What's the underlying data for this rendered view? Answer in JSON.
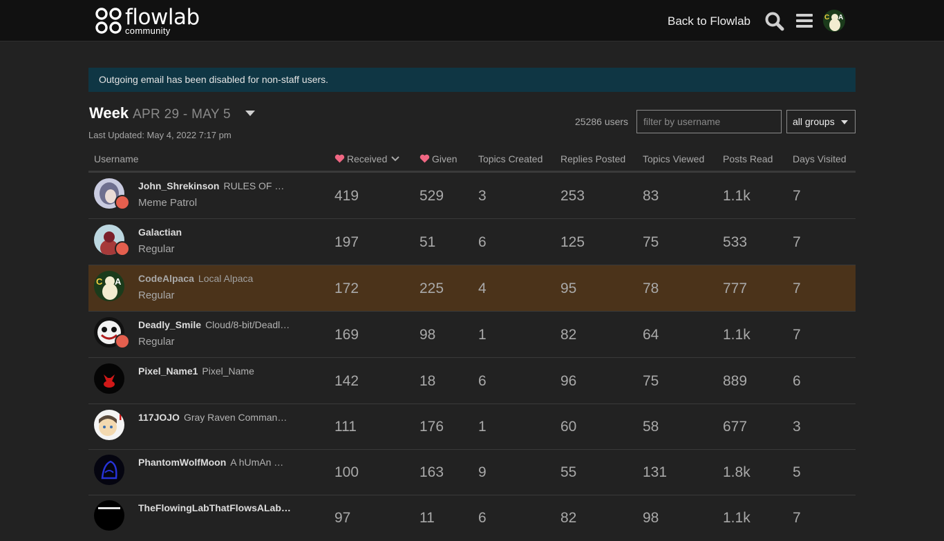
{
  "header": {
    "logo_name": "flowlab",
    "logo_sub": "community",
    "back_link": "Back to Flowlab",
    "search_icon": "search-icon",
    "menu_icon": "hamburger-icon"
  },
  "alert": "Outgoing email has been disabled for non-staff users.",
  "period": {
    "word": "Week",
    "range": "APR 29 - MAY 5",
    "last_updated": "Last Updated: May 4, 2022 7:17 pm"
  },
  "filters": {
    "user_count": "25286 users",
    "placeholder": "filter by username",
    "group": "all groups"
  },
  "columns": {
    "username": "Username",
    "received": "Received",
    "given": "Given",
    "topics_created": "Topics Created",
    "replies_posted": "Replies Posted",
    "topics_viewed": "Topics Viewed",
    "posts_read": "Posts Read",
    "days_visited": "Days Visited"
  },
  "colors": {
    "highlight_row": "#4b331a",
    "heart": "#f06783",
    "badge": "#e45f4e",
    "alert_bg": "#0f3644"
  },
  "rows": [
    {
      "name": "John_Shrekinson",
      "title": "RULES OF …",
      "group": "Meme Patrol",
      "received": "419",
      "given": "529",
      "topics_created": "3",
      "replies_posted": "253",
      "topics_viewed": "83",
      "posts_read": "1.1k",
      "days_visited": "7"
    },
    {
      "name": "Galactian",
      "title": "",
      "group": "Regular",
      "received": "197",
      "given": "51",
      "topics_created": "6",
      "replies_posted": "125",
      "topics_viewed": "75",
      "posts_read": "533",
      "days_visited": "7"
    },
    {
      "name": "CodeAlpaca",
      "title": "Local Alpaca",
      "group": "Regular",
      "received": "172",
      "given": "225",
      "topics_created": "4",
      "replies_posted": "95",
      "topics_viewed": "78",
      "posts_read": "777",
      "days_visited": "7"
    },
    {
      "name": "Deadly_Smile",
      "title": "Cloud/8-bit/Deadl…",
      "group": "Regular",
      "received": "169",
      "given": "98",
      "topics_created": "1",
      "replies_posted": "82",
      "topics_viewed": "64",
      "posts_read": "1.1k",
      "days_visited": "7"
    },
    {
      "name": "Pixel_Name1",
      "title": "Pixel_Name",
      "group": "",
      "received": "142",
      "given": "18",
      "topics_created": "6",
      "replies_posted": "96",
      "topics_viewed": "75",
      "posts_read": "889",
      "days_visited": "6"
    },
    {
      "name": "117JOJO",
      "title": "Gray Raven Comman…",
      "group": "",
      "received": "111",
      "given": "176",
      "topics_created": "1",
      "replies_posted": "60",
      "topics_viewed": "58",
      "posts_read": "677",
      "days_visited": "3"
    },
    {
      "name": "PhantomWolfMoon",
      "title": "A hUmAn …",
      "group": "",
      "received": "100",
      "given": "163",
      "topics_created": "9",
      "replies_posted": "55",
      "topics_viewed": "131",
      "posts_read": "1.8k",
      "days_visited": "5"
    },
    {
      "name": "TheFlowingLabThatFlowsALab…",
      "title": "",
      "group": "",
      "received": "97",
      "given": "11",
      "topics_created": "6",
      "replies_posted": "82",
      "topics_viewed": "98",
      "posts_read": "1.1k",
      "days_visited": "7"
    }
  ]
}
